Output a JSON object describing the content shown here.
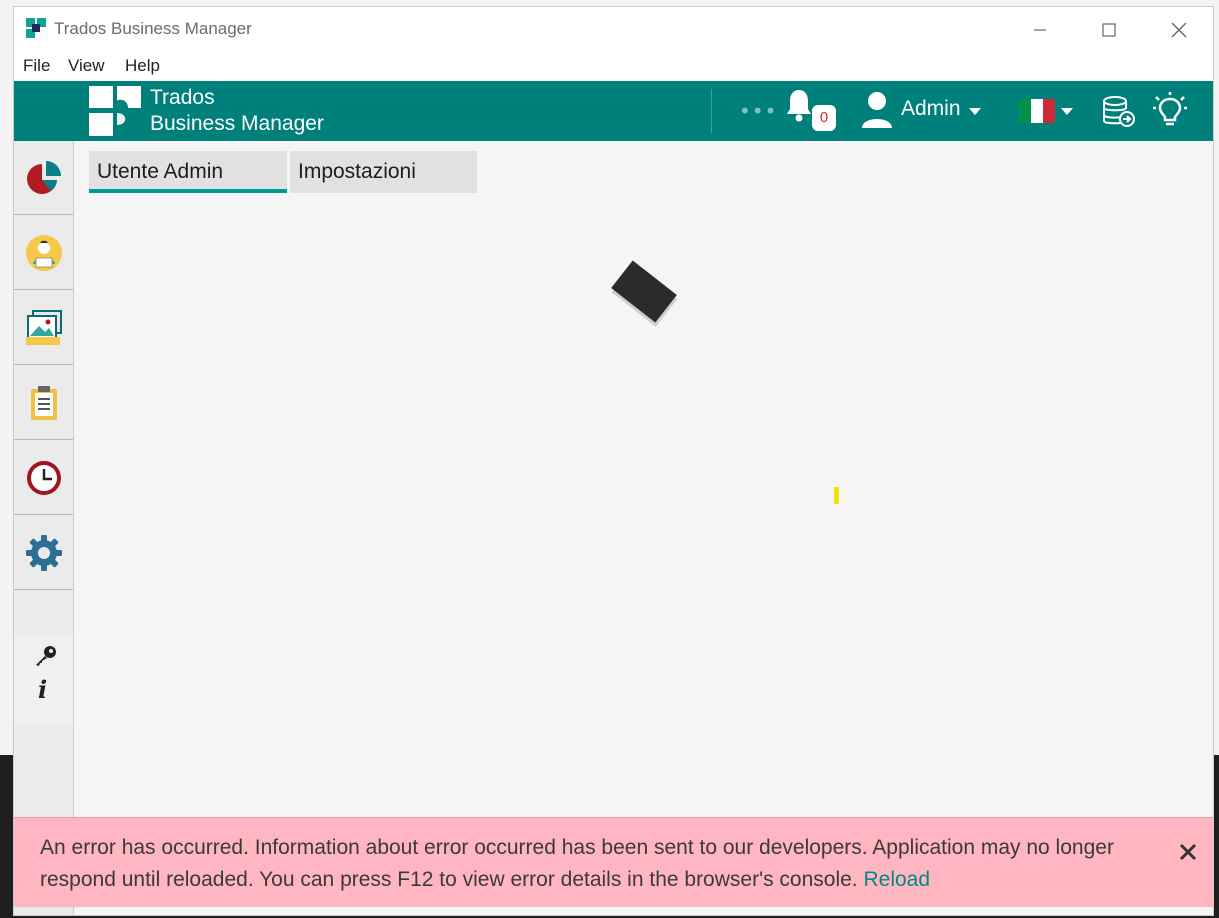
{
  "window": {
    "title": "Trados Business Manager"
  },
  "menu": [
    {
      "label": "File"
    },
    {
      "label": "View"
    },
    {
      "label": "Help"
    }
  ],
  "header": {
    "brand_line1": "Trados",
    "brand_line2": "Business Manager",
    "more": "•••",
    "notifications_count": "0",
    "user_name": "Admin",
    "language_flag": "italy-flag",
    "colors": {
      "header_bg": "#00807a",
      "flag_green": "#009246",
      "flag_white": "#ffffff",
      "flag_red": "#ce2b37"
    }
  },
  "sidebar": {
    "items": [
      {
        "icon": "pie-chart-icon"
      },
      {
        "icon": "user-desk-icon"
      },
      {
        "icon": "gallery-icon"
      },
      {
        "icon": "clipboard-icon"
      },
      {
        "icon": "clock-icon"
      },
      {
        "icon": "gear-icon"
      }
    ],
    "extra": [
      {
        "icon": "key-icon"
      },
      {
        "icon": "info-icon",
        "glyph": "i"
      }
    ]
  },
  "tabs": [
    {
      "label": "Utente Admin",
      "active": true
    },
    {
      "label": "Impostazioni",
      "active": false
    }
  ],
  "error": {
    "message": "An error has occurred. Information about error occurred has been sent to our developers. Application may no longer respond until reloaded. You can press F12 to view error details in the browser's console.",
    "reload_label": "Reload",
    "bg_color": "#ffb6c1",
    "link_color": "#008a84"
  }
}
